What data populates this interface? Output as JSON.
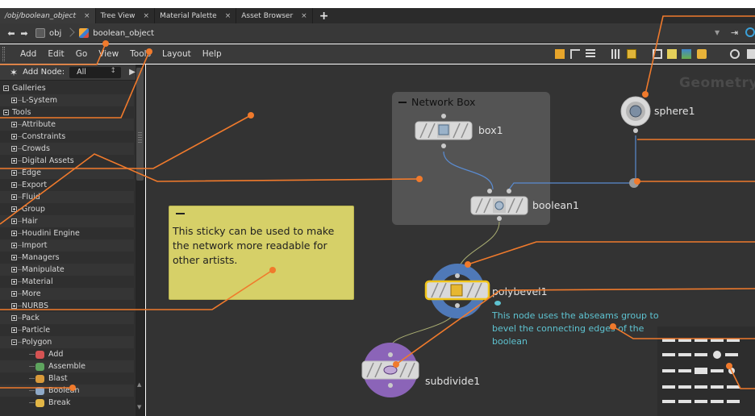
{
  "tabs": [
    {
      "label": "/obj/boolean_object",
      "active": true
    },
    {
      "label": "Tree View",
      "active": false
    },
    {
      "label": "Material Palette",
      "active": false
    },
    {
      "label": "Asset Browser",
      "active": false
    }
  ],
  "tab_close_glyph": "×",
  "tab_add_glyph": "+",
  "path": {
    "back_icon": "back-arrow-icon",
    "forward_icon": "forward-arrow-icon",
    "crumbs": [
      "obj",
      "boolean_object"
    ]
  },
  "menu": [
    "Add",
    "Edit",
    "Go",
    "View",
    "Tools",
    "Layout",
    "Help"
  ],
  "add_node": {
    "label": "Add Node:",
    "filter": "All"
  },
  "tree": [
    {
      "label": "Galleries",
      "level": 0,
      "state": "minus"
    },
    {
      "label": "L-System",
      "level": 1,
      "state": "plus"
    },
    {
      "label": "Tools",
      "level": 0,
      "state": "minus"
    },
    {
      "label": "Attribute",
      "level": 1,
      "state": "plus"
    },
    {
      "label": "Constraints",
      "level": 1,
      "state": "plus"
    },
    {
      "label": "Crowds",
      "level": 1,
      "state": "plus"
    },
    {
      "label": "Digital Assets",
      "level": 1,
      "state": "plus"
    },
    {
      "label": "Edge",
      "level": 1,
      "state": "plus"
    },
    {
      "label": "Export",
      "level": 1,
      "state": "plus"
    },
    {
      "label": "Fluid",
      "level": 1,
      "state": "plus"
    },
    {
      "label": "Group",
      "level": 1,
      "state": "plus"
    },
    {
      "label": "Hair",
      "level": 1,
      "state": "plus"
    },
    {
      "label": "Houdini Engine",
      "level": 1,
      "state": "plus"
    },
    {
      "label": "Import",
      "level": 1,
      "state": "plus"
    },
    {
      "label": "Managers",
      "level": 1,
      "state": "plus"
    },
    {
      "label": "Manipulate",
      "level": 1,
      "state": "plus"
    },
    {
      "label": "Material",
      "level": 1,
      "state": "plus"
    },
    {
      "label": "More",
      "level": 1,
      "state": "plus"
    },
    {
      "label": "NURBS",
      "level": 1,
      "state": "plus"
    },
    {
      "label": "Pack",
      "level": 1,
      "state": "plus"
    },
    {
      "label": "Particle",
      "level": 1,
      "state": "plus"
    },
    {
      "label": "Polygon",
      "level": 1,
      "state": "minus"
    },
    {
      "label": "Add",
      "level": 2,
      "state": "leaf",
      "icon": "add-tool-icon"
    },
    {
      "label": "Assemble",
      "level": 2,
      "state": "leaf",
      "icon": "assemble-tool-icon"
    },
    {
      "label": "Blast",
      "level": 2,
      "state": "leaf",
      "icon": "blast-tool-icon"
    },
    {
      "label": "Boolean",
      "level": 2,
      "state": "leaf",
      "icon": "boolean-tool-icon"
    },
    {
      "label": "Break",
      "level": 2,
      "state": "leaf",
      "icon": "break-tool-icon"
    }
  ],
  "canvas": {
    "watermark": "Geometry",
    "network_box_title": "Network Box",
    "sticky_text": "This sticky can be used to make the network more readable for other artists.",
    "nodes": {
      "box1": "box1",
      "boolean1": "boolean1",
      "sphere1": "sphere1",
      "polybevel1": "polybevel1",
      "subdivide1": "subdivide1"
    },
    "polybevel_comment": "This node uses the abseams group to bevel the connecting edges of the boolean"
  },
  "colors": {
    "callout": "#f07a2c",
    "comment": "#5ec3d1",
    "sticky": "#d6d068",
    "selected_node": "#f0c419",
    "bevel_ring": "#4f79b8",
    "subdivide_ring": "#8b64b8"
  }
}
